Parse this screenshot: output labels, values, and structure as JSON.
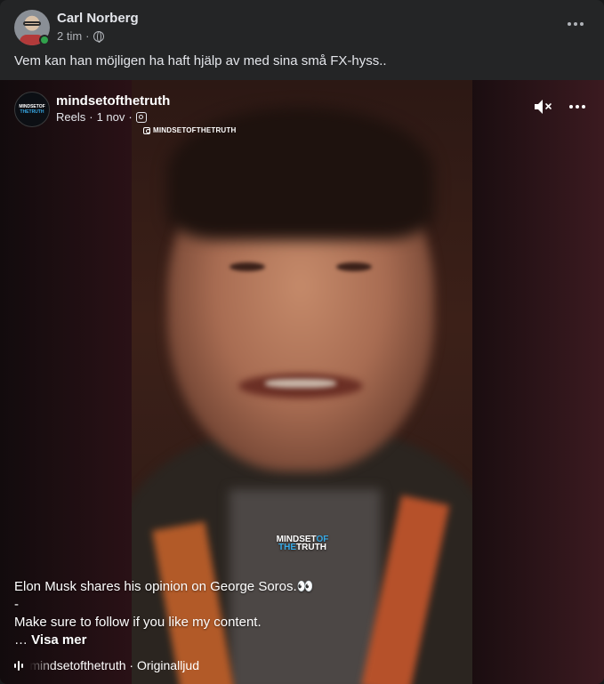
{
  "post": {
    "author_name": "Carl Norberg",
    "time": "2 tim",
    "meta_separator": "·",
    "privacy_icon": "globe-icon",
    "text": "Vem kan han möjligen ha haft hjälp av med sina små FX-hyss.."
  },
  "reel": {
    "page_name": "mindsetofthetruth",
    "type_label": "Reels",
    "date": "1 nov",
    "separator": "·",
    "source_icon": "instagram-icon",
    "watermark": "MINDSETOFTHETRUTH",
    "logo_line1": "MINDSET",
    "logo_of": "OF",
    "logo_line2": "THE",
    "logo_truth": "TRUTH",
    "avatar_line1": "MINDSETOF",
    "avatar_line2": "THETRUTH",
    "caption": {
      "line1": "Elon Musk shares his opinion on George Soros.👀",
      "line2": "-",
      "line3": "Make sure to follow if you like my content.",
      "ellipsis": "… ",
      "see_more": "Visa mer"
    },
    "audio": {
      "text": "mindsetofthetruth · Originalljud"
    },
    "mute_icon": "speaker-muted-icon"
  }
}
